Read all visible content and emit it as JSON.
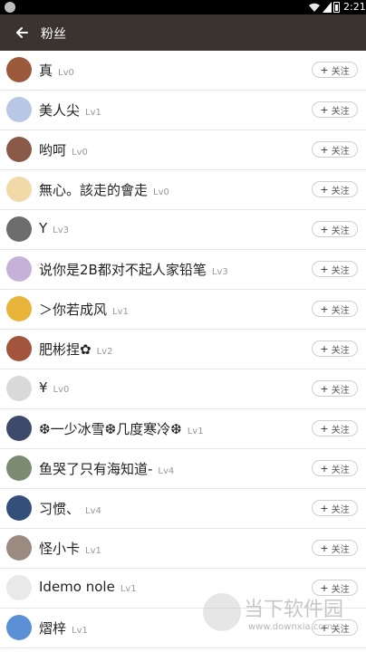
{
  "status_bar": {
    "time": "2:21"
  },
  "header": {
    "title": "粉丝"
  },
  "follow_label": "关注",
  "follow_plus": "+",
  "fans": [
    {
      "name": "真",
      "level": "Lv0",
      "avatar_color": "#9c5a3c"
    },
    {
      "name": "美人尖",
      "level": "Lv1",
      "avatar_color": "#b9c7e6"
    },
    {
      "name": "哟呵",
      "level": "Lv0",
      "avatar_color": "#8a5a48"
    },
    {
      "name": "無心。該走的會走",
      "level": "Lv0",
      "avatar_color": "#f2d9a8"
    },
    {
      "name": "Y",
      "level": "Lv3",
      "avatar_color": "#6d6d6d"
    },
    {
      "name": "说你是2B都对不起人家铅笔",
      "level": "Lv3",
      "avatar_color": "#c6b2d9"
    },
    {
      "name": "＞你若成风",
      "level": "Lv1",
      "avatar_color": "#e8b43a"
    },
    {
      "name": "肥彬捏✿",
      "level": "Lv2",
      "avatar_color": "#a3543d"
    },
    {
      "name": "¥",
      "level": "Lv0",
      "avatar_color": "#d9d9d9"
    },
    {
      "name": "❆一少冰雪❆几度寒冷❆",
      "level": "Lv1",
      "avatar_color": "#3e4a6b"
    },
    {
      "name": "鱼哭了只有海知道-",
      "level": "Lv4",
      "avatar_color": "#7b8c72"
    },
    {
      "name": "习惯、",
      "level": "Lv4",
      "avatar_color": "#34507a"
    },
    {
      "name": "怪小卡",
      "level": "Lv1",
      "avatar_color": "#9a8a80"
    },
    {
      "name": "Idemo nole",
      "level": "Lv1",
      "avatar_color": "#e9e9e9"
    },
    {
      "name": "熠梓",
      "level": "Lv1",
      "avatar_color": "#5b8fd6"
    }
  ],
  "watermark": {
    "title": "当下软件园",
    "url": "www.downxia.com"
  }
}
